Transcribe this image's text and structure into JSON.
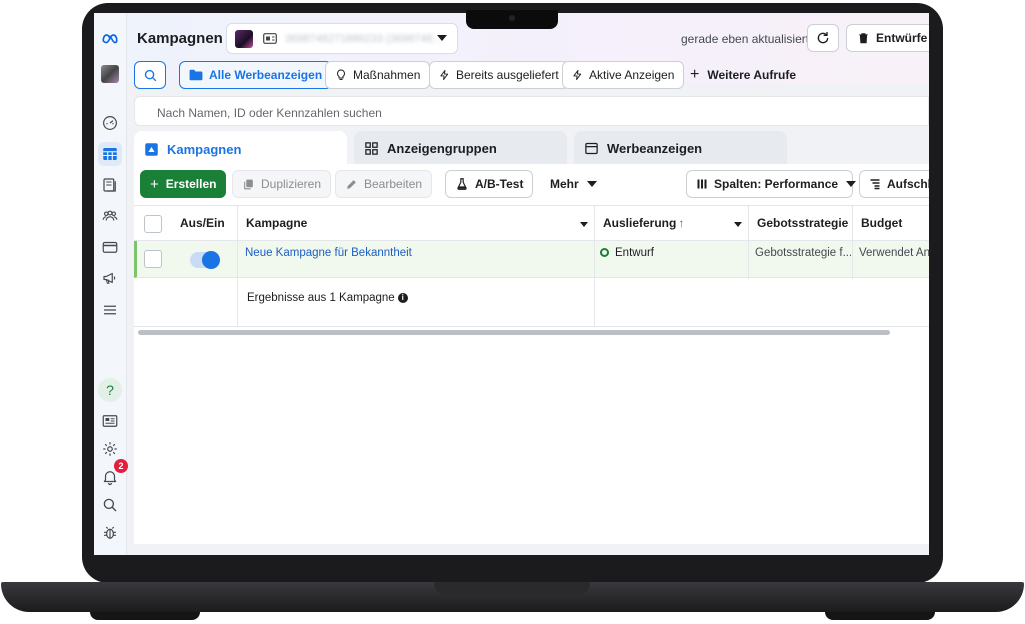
{
  "header": {
    "title": "Kampagnen",
    "account_card_label": "⊟",
    "account_id_blurred": "3698748271886233 (3698748...",
    "updated_text": "gerade eben aktualisiert",
    "drafts_label": "Entwürfe verwerfen"
  },
  "filters": {
    "all_ads": "Alle Werbeanzeigen",
    "actions": "Maßnahmen",
    "delivered": "Bereits ausgeliefert",
    "active_ads": "Aktive Anzeigen",
    "more_views": "Weitere Aufrufe"
  },
  "search": {
    "placeholder": "Nach Namen, ID oder Kennzahlen suchen"
  },
  "tabs": {
    "campaigns": "Kampagnen",
    "adsets": "Anzeigengruppen",
    "ads": "Werbeanzeigen"
  },
  "toolbar": {
    "create": "Erstellen",
    "duplicate": "Duplizieren",
    "edit": "Bearbeiten",
    "ab_test": "A/B-Test",
    "more": "Mehr",
    "columns": "Spalten: Performance",
    "breakdown": "Aufschlüsselung"
  },
  "table": {
    "headers": {
      "onoff": "Aus/Ein",
      "campaign": "Kampagne",
      "delivery": "Auslieferung",
      "delivery_sort": "↑",
      "bid_strategy": "Gebotsstrategie",
      "budget": "Budget"
    },
    "rows": [
      {
        "campaign": "Neue Kampagne für Bekanntheit",
        "delivery": "Entwurf",
        "bid_strategy": "Gebotsstrategie f...",
        "budget": "Verwendet Anzeigengruppen-Budget",
        "toggle_on": true
      }
    ],
    "summary": "Ergebnisse aus 1 Kampagne"
  },
  "sidebar": {
    "notification_count": "2",
    "help_label": "?"
  },
  "colors": {
    "accent": "#1b74e4",
    "create_green": "#1a7f37",
    "row_highlight": "#f1f8ee",
    "notification_red": "#e41e3f"
  }
}
